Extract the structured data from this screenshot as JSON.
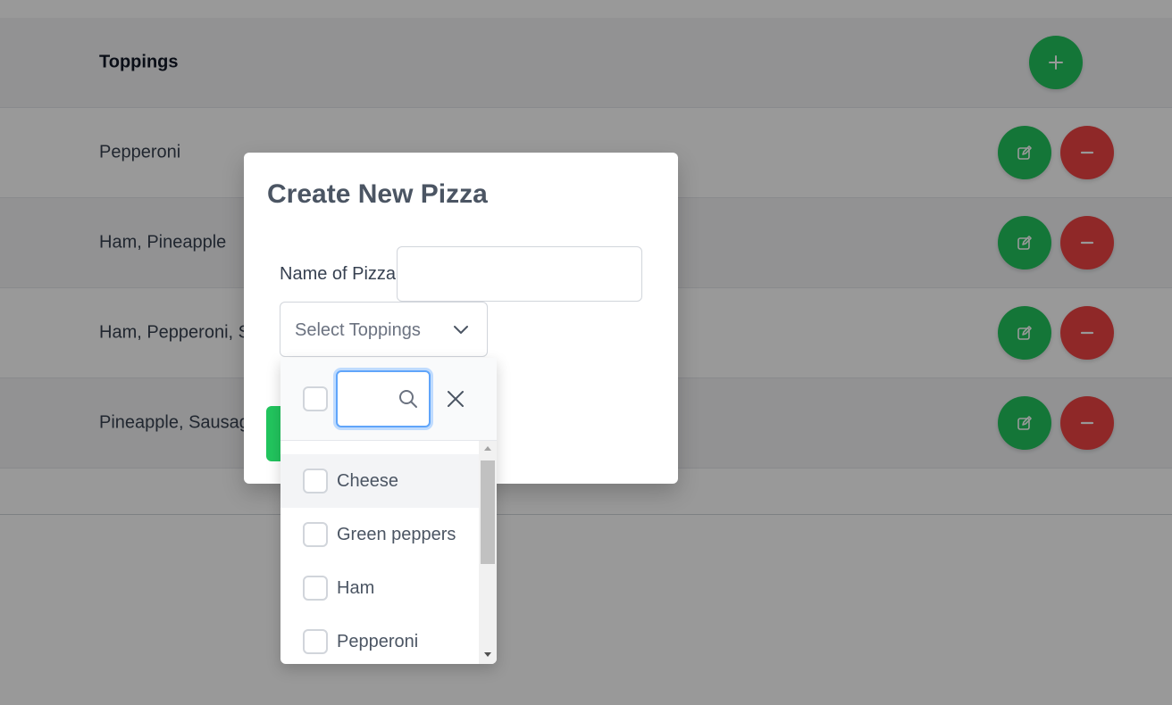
{
  "table": {
    "header_label": "Toppings",
    "rows": [
      {
        "label": "Pepperoni"
      },
      {
        "label": "Ham, Pineapple"
      },
      {
        "label": "Ham, Pepperoni, S"
      },
      {
        "label": "Pineapple, Sausag"
      }
    ]
  },
  "modal": {
    "title": "Create New Pizza",
    "name_label": "Name of Pizza",
    "name_value": "",
    "select_placeholder": "Select Toppings"
  },
  "dropdown": {
    "search_value": "",
    "options": [
      {
        "label": "Cheese",
        "checked": false
      },
      {
        "label": "Green peppers",
        "checked": false
      },
      {
        "label": "Ham",
        "checked": false
      },
      {
        "label": "Pepperoni",
        "checked": false
      }
    ],
    "hovered_index": 0
  },
  "colors": {
    "primary_green": "#22c55e",
    "danger_red": "#ef4444",
    "focus_blue": "#60a5fa"
  },
  "icons": {
    "add": "plus-icon",
    "edit": "edit-icon",
    "delete": "minus-icon",
    "chevron": "chevron-down-icon",
    "search": "search-icon",
    "clear": "close-icon"
  }
}
